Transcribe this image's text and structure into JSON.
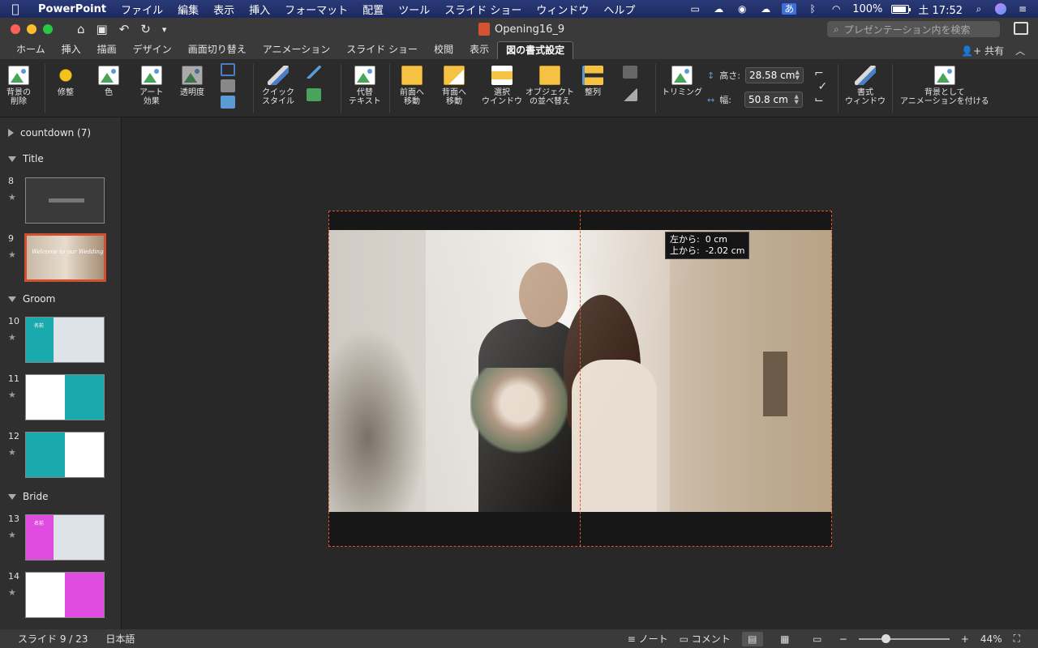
{
  "menubar": {
    "app": "PowerPoint",
    "items": [
      "ファイル",
      "編集",
      "表示",
      "挿入",
      "フォーマット",
      "配置",
      "ツール",
      "スライド ショー",
      "ウィンドウ",
      "ヘルプ"
    ],
    "ime": "あ",
    "battery": "100%",
    "clock": "土 17:52"
  },
  "titlebar": {
    "title": "Opening16_9",
    "search_placeholder": "プレゼンテーション内を検索"
  },
  "tabs": {
    "items": [
      "ホーム",
      "挿入",
      "描画",
      "デザイン",
      "画面切り替え",
      "アニメーション",
      "スライド ショー",
      "校閲",
      "表示",
      "図の書式設定"
    ],
    "active": "図の書式設定",
    "share": "共有"
  },
  "ribbon": {
    "remove_bg": "背景の\n削除",
    "corrections": "修整",
    "color": "色",
    "art_effects": "アート\n効果",
    "transparency": "透明度",
    "quick_styles": "クイック\nスタイル",
    "alt_text": "代替\nテキスト",
    "bring_forward": "前面へ\n移動",
    "send_backward": "背面へ\n移動",
    "selection_pane": "選択\nウインドウ",
    "arrange_objects": "オブジェクト\nの並べ替え",
    "align": "整列",
    "crop": "トリミング",
    "height_label": "高さ:",
    "height_value": "28.58 cm",
    "width_label": "幅:",
    "width_value": "50.8 cm",
    "format_pane": "書式\nウィンドウ",
    "animate_bg": "背景として\nアニメーションを付ける"
  },
  "sidebar": {
    "sections": [
      {
        "name": "countdown (7)",
        "collapsed": true
      },
      {
        "name": "Title",
        "collapsed": false
      },
      {
        "name": "Groom",
        "collapsed": false
      },
      {
        "name": "Bride",
        "collapsed": false
      }
    ],
    "slides": [
      "8",
      "9",
      "10",
      "11",
      "12",
      "13",
      "14"
    ],
    "thumb9_text": "Welcome to our Wedding",
    "thumb10_text": "名前"
  },
  "canvas": {
    "tooltip": "左から:  0 cm\n上から:  -2.02 cm"
  },
  "statusbar": {
    "slide": "スライド 9 / 23",
    "language": "日本語",
    "notes": "ノート",
    "comments": "コメント",
    "zoom": "44%",
    "zoom_level": 0.3
  },
  "colors": {
    "accent": "#d14f2f",
    "teal": "#1aa9ad",
    "magenta": "#e04be0",
    "menubar": "#1f2d63"
  }
}
